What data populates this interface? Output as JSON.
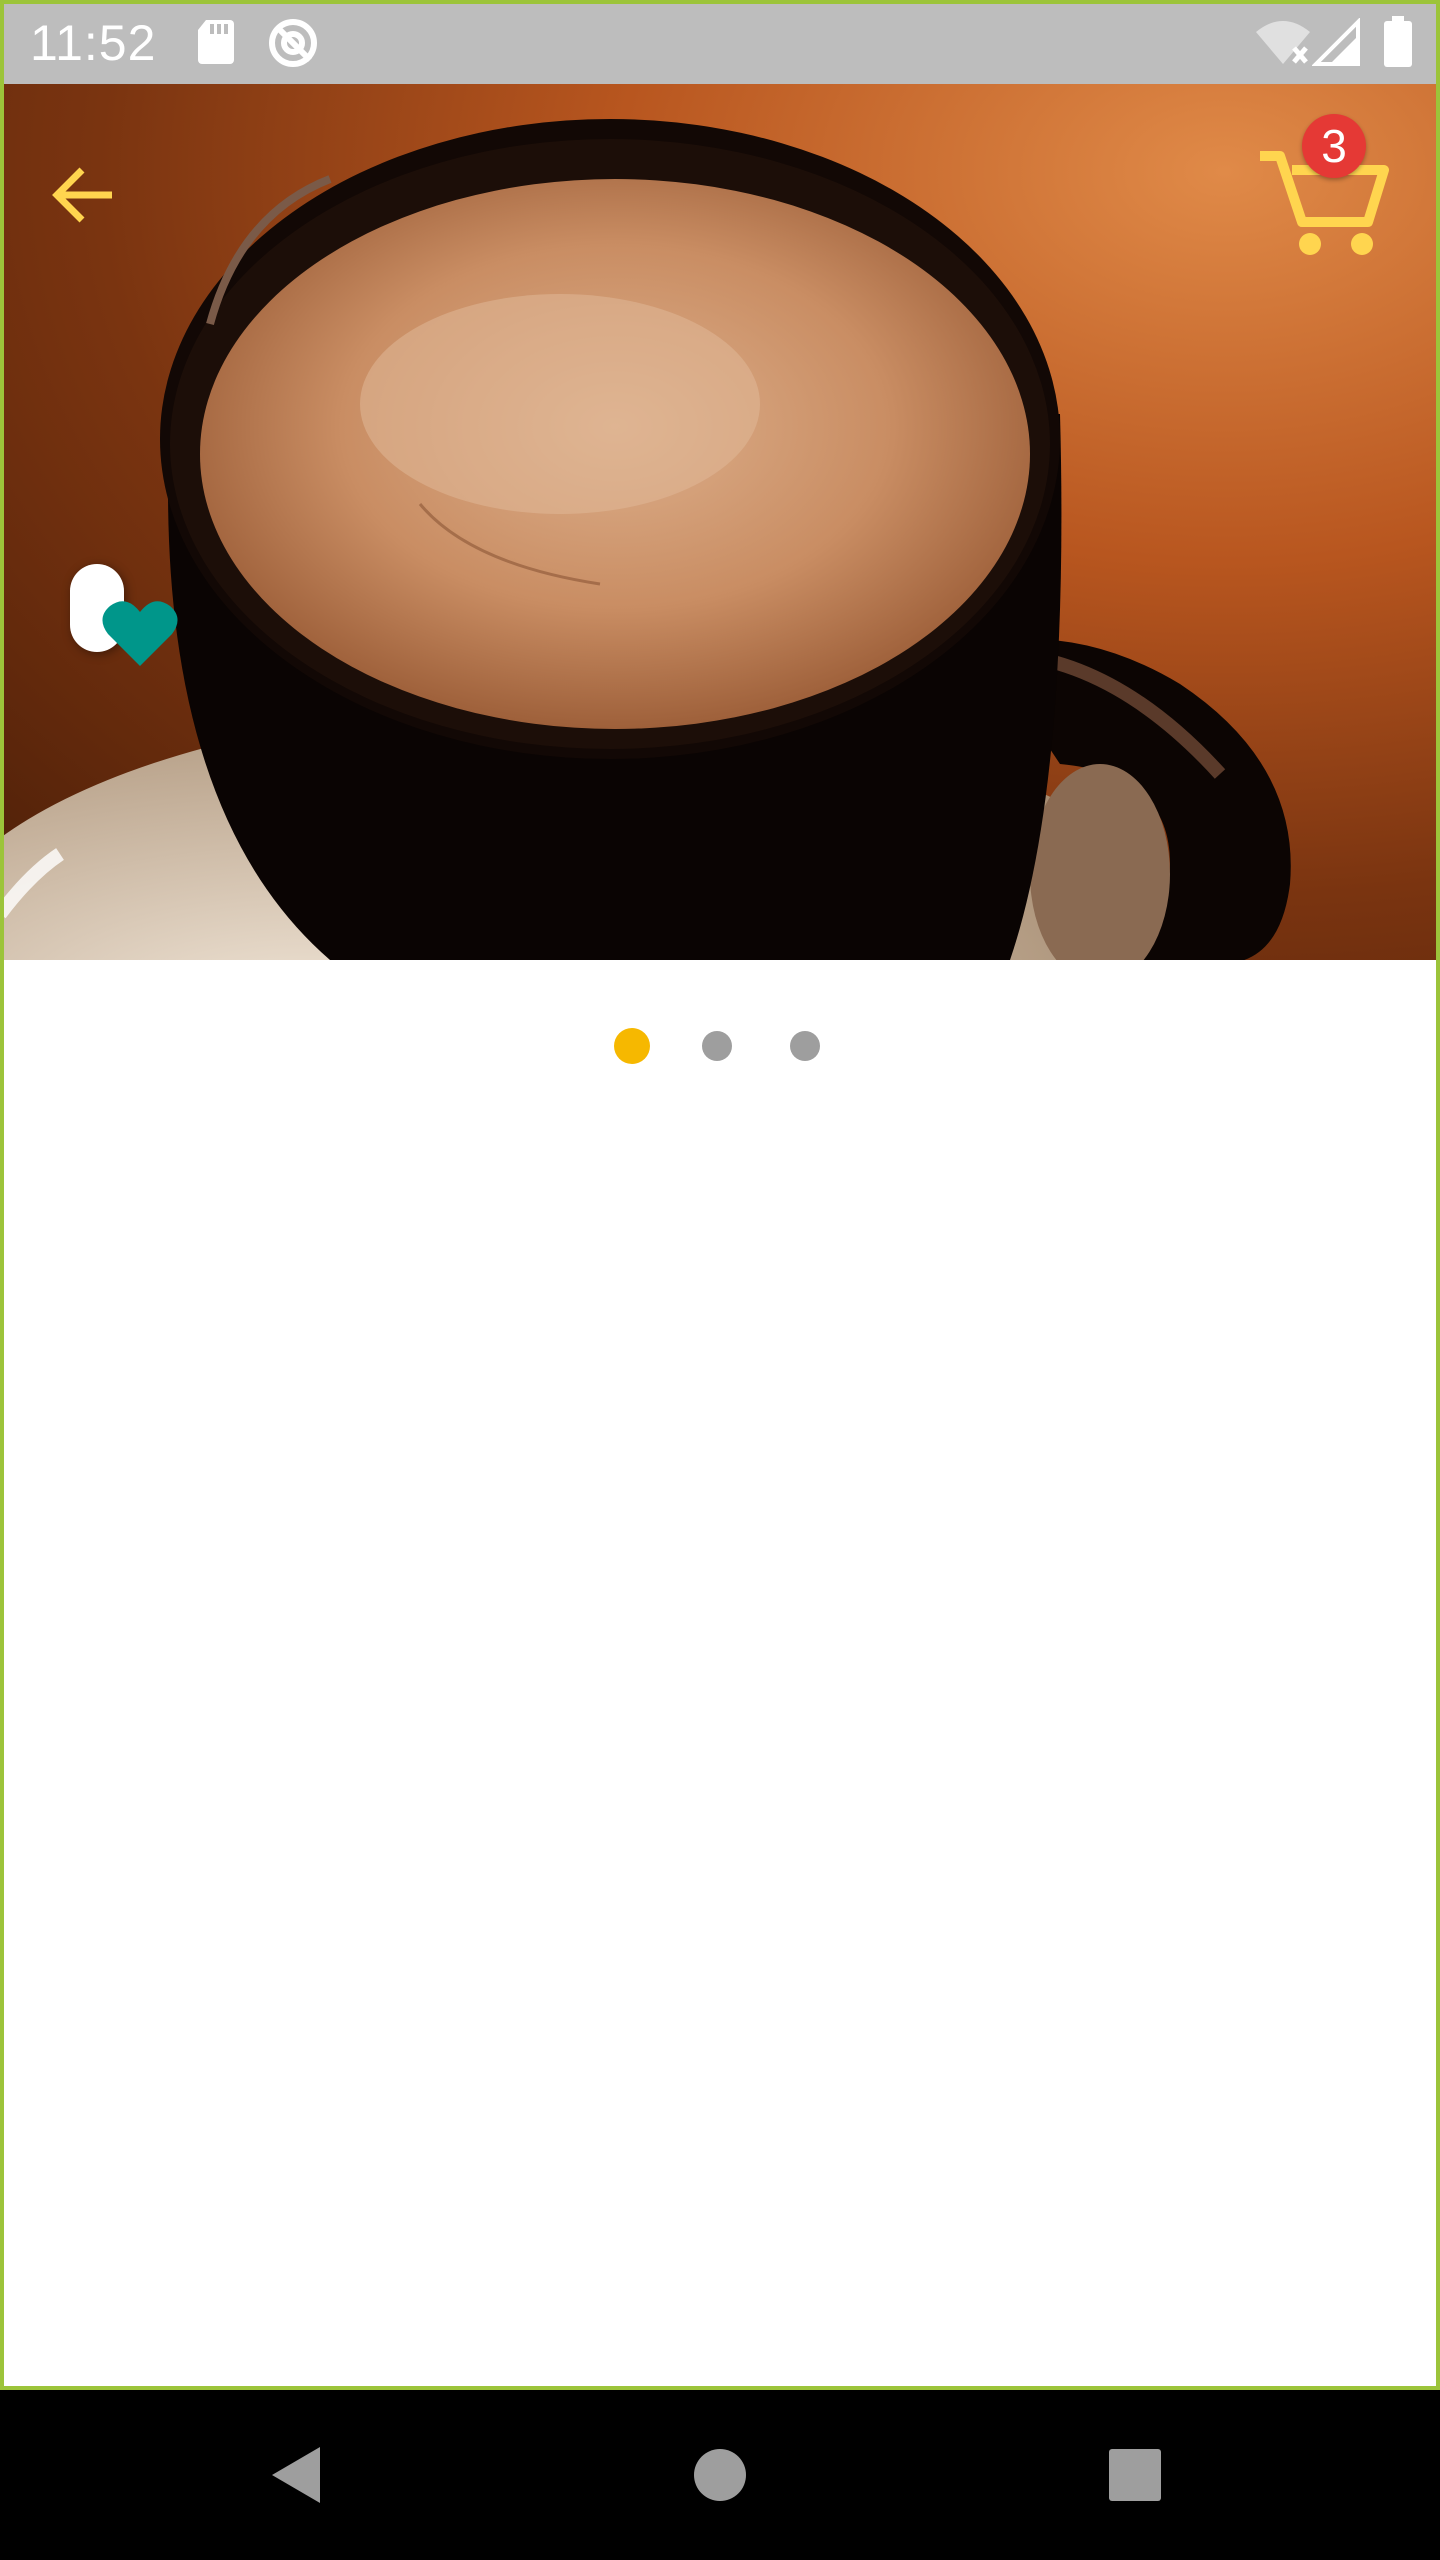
{
  "status_bar": {
    "time": "11:52",
    "icons": [
      "sd-card-icon",
      "sync-disabled-icon",
      "wifi-off-icon",
      "signal-icon",
      "battery-icon"
    ]
  },
  "toolbar": {
    "back_icon": "arrow-left-icon",
    "cart_icon": "cart-icon",
    "cart_count": "3",
    "accent_color": "#ffd54f",
    "badge_color": "#e53935"
  },
  "hero": {
    "image": "coffee-cup-photo",
    "favorite_icon": "heart-icon",
    "favorite_color": "#00968a"
  },
  "pager": {
    "pages": 3,
    "active_index": 0,
    "active_color": "#f6b800",
    "inactive_color": "#9e9e9e"
  },
  "nav_bar": {
    "icons": [
      "back-triangle-icon",
      "home-circle-icon",
      "recents-square-icon"
    ]
  }
}
